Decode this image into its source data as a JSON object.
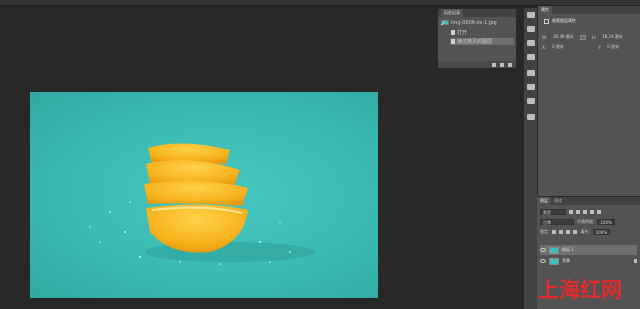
{
  "history": {
    "tab_label": "历史记录",
    "document_name": "img-0006-zx-1.jpg",
    "steps": [
      {
        "label": "打开",
        "selected": false
      },
      {
        "label": "通过拷贝的图层",
        "selected": true
      }
    ]
  },
  "properties": {
    "tab_label": "属性",
    "title": "像素图层属性",
    "w_label": "W:",
    "w_value": "30.48 厘米",
    "go_label": "GO",
    "h_label": "H:",
    "h_value": "18.24 厘米",
    "x_label": "X:",
    "x_value": "0 厘米",
    "y_label": "Y:",
    "y_value": "0 厘米"
  },
  "layers": {
    "tabs": [
      "图层",
      "通道"
    ],
    "kind_label": "类型",
    "blend_mode": "正常",
    "opacity_label": "不透明度:",
    "opacity_value": "100%",
    "lock_label": "锁定:",
    "fill_label": "填充:",
    "fill_value": "100%",
    "items": [
      {
        "name": "图层 1",
        "selected": true
      },
      {
        "name": "背景",
        "selected": false
      }
    ]
  },
  "watermark": "上海红网",
  "colors": {
    "canvas_bg": "#282828",
    "panel_bg": "#535353",
    "image_teal": "#3bbab3",
    "lemon": "#f6b21f",
    "watermark_red": "#e12d2d"
  }
}
